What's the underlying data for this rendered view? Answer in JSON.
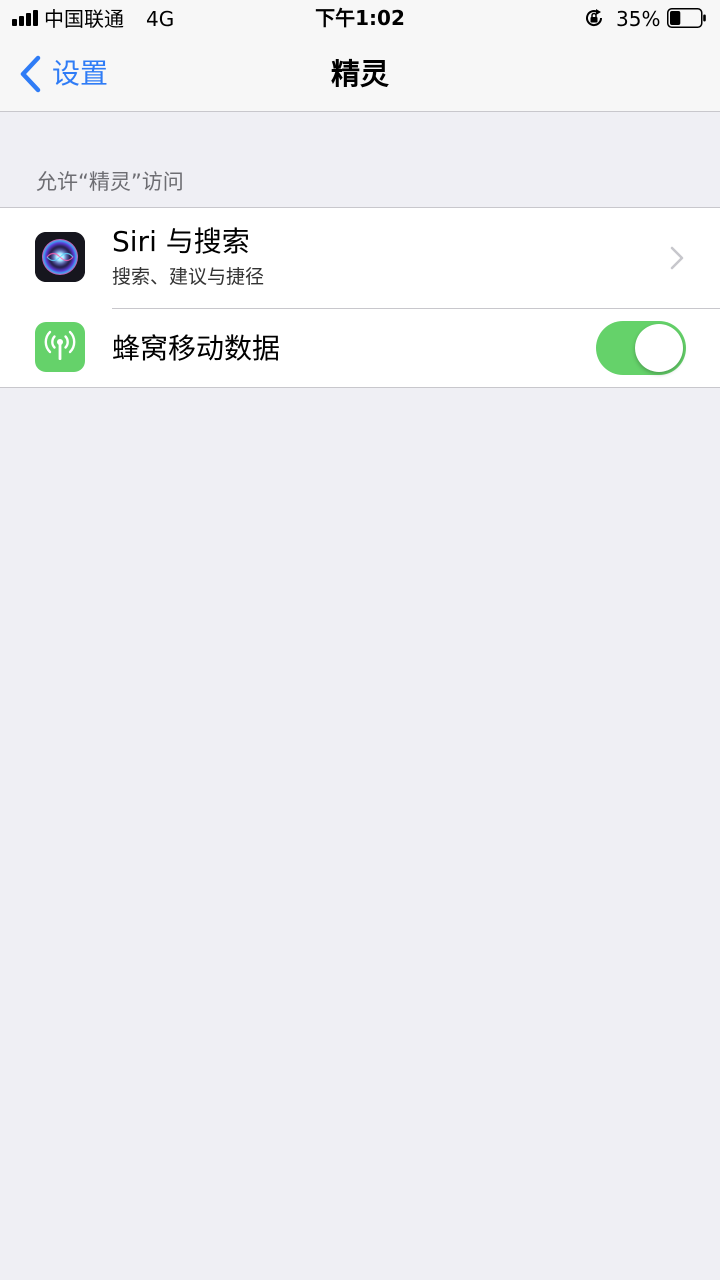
{
  "status_bar": {
    "carrier": "中国联通",
    "network": "4G",
    "time": "下午1:02",
    "battery_percent": "35%",
    "battery_level": 0.35,
    "icons": [
      "cellular-signal-icon",
      "rotation-lock-icon",
      "battery-icon"
    ]
  },
  "nav": {
    "back_label": "设置",
    "title": "精灵",
    "back_icon": "chevron-left-icon"
  },
  "section": {
    "header": "允许“精灵”访问"
  },
  "cells": {
    "siri": {
      "title": "Siri 与搜索",
      "subtitle": "搜索、建议与捷径",
      "icon": "siri-icon",
      "accessory": "chevron-right-icon"
    },
    "cellular": {
      "title": "蜂窝移动数据",
      "icon": "cellular-antenna-icon",
      "toggle_on": true
    }
  },
  "colors": {
    "accent": "#2f7cf6",
    "toggle_on": "#65d26a",
    "background": "#efeff4",
    "nav_background": "#f7f7f7",
    "cell_background": "#ffffff",
    "separator": "#c8c7cc",
    "section_header_text": "#6d6d72"
  }
}
